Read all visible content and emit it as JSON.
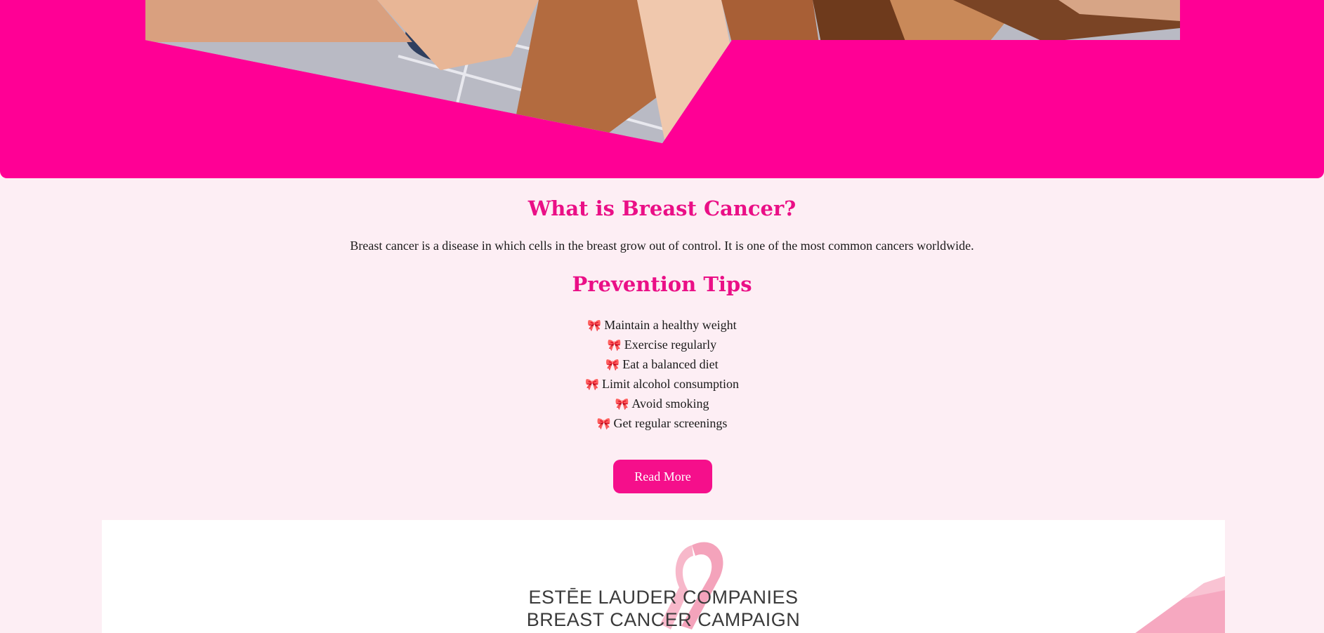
{
  "hero": {
    "image_alt": "Hands joined together in a circle"
  },
  "about": {
    "heading": "What is Breast Cancer?",
    "text": "Breast cancer is a disease in which cells in the breast grow out of control. It is one of the most common cancers worldwide."
  },
  "prevention": {
    "heading": "Prevention Tips",
    "tips": [
      {
        "icon": "ribbon-icon",
        "text": "Maintain a healthy weight"
      },
      {
        "icon": "ribbon-icon",
        "text": "Exercise regularly"
      },
      {
        "icon": "ribbon-icon",
        "text": "Eat a balanced diet"
      },
      {
        "icon": "ribbon-icon",
        "text": "Limit alcohol consumption"
      },
      {
        "icon": "ribbon-icon",
        "text": "Avoid smoking"
      },
      {
        "icon": "ribbon-icon",
        "text": "Get regular screenings"
      }
    ]
  },
  "read_more_label": "Read More",
  "banner": {
    "line1": "ESTĒE LAUDER COMPANIES",
    "line2": "BREAST CANCER CAMPAIGN"
  },
  "colors": {
    "accent": "#ff0095",
    "heading": "#ea0f86",
    "button": "#f50f8b",
    "background": "#fdeef4"
  }
}
